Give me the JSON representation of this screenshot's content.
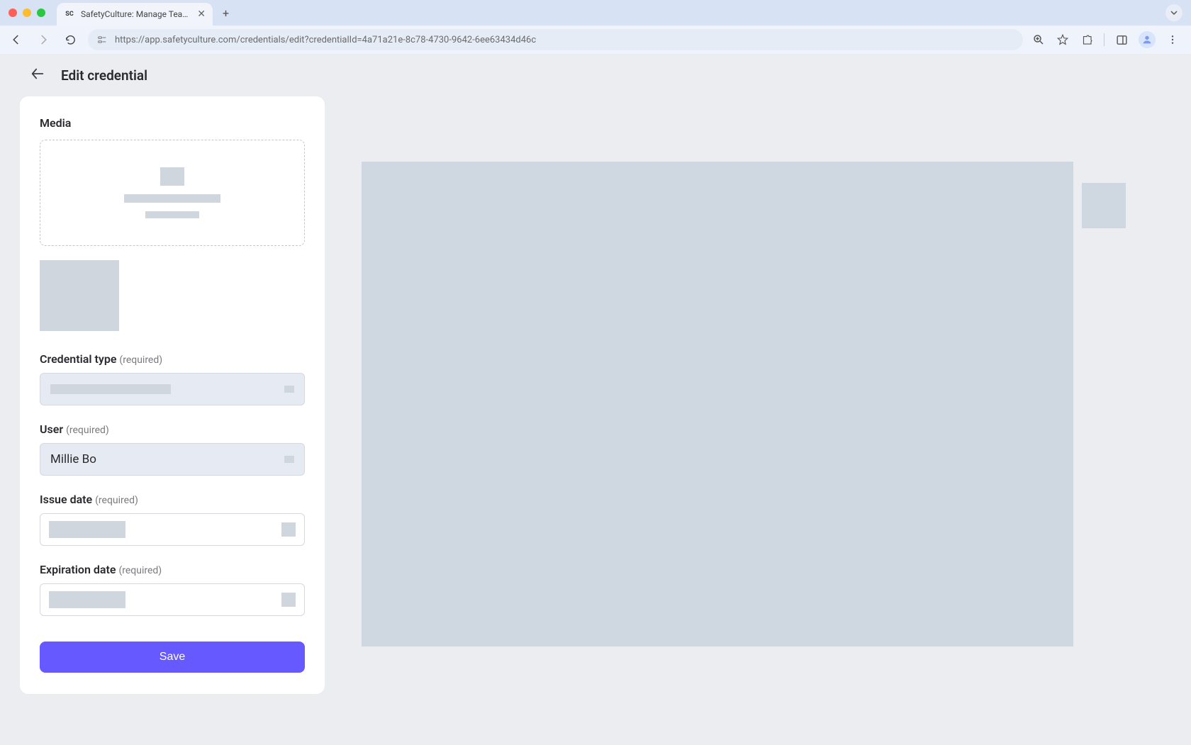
{
  "browser": {
    "tab_title": "SafetyCulture: Manage Teams and…",
    "url": "https://app.safetyculture.com/credentials/edit?credentialId=4a71a21e-8c78-4730-9642-6ee63434d46c"
  },
  "header": {
    "title": "Edit credential"
  },
  "form": {
    "media_label": "Media",
    "credential_type": {
      "label": "Credential type",
      "required_text": "(required)"
    },
    "user": {
      "label": "User",
      "required_text": "(required)",
      "value": "Millie Bo"
    },
    "issue_date": {
      "label": "Issue date",
      "required_text": "(required)"
    },
    "expiration_date": {
      "label": "Expiration date",
      "required_text": "(required)"
    },
    "save_label": "Save"
  }
}
